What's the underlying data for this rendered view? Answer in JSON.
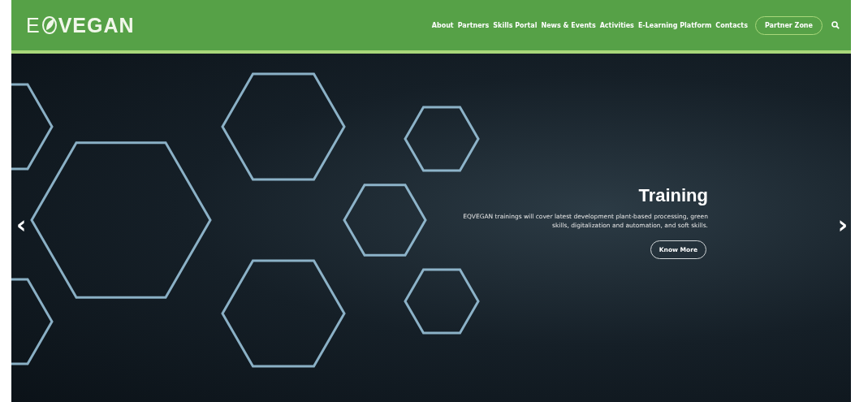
{
  "logo": {
    "before": "E",
    "after": "VEGAN"
  },
  "nav": {
    "links": [
      "About",
      "Partners",
      "Skills Portal",
      "News & Events",
      "Activities",
      "E-Learning Platform",
      "Contacts"
    ],
    "button": "Partner Zone"
  },
  "slide": {
    "title": "Training",
    "text": "EQVEGAN trainings will cover latest development plant-based processing, green skills, digitalization and automation, and soft skills.",
    "button": "Know More",
    "prev": "‹",
    "next": "›"
  }
}
